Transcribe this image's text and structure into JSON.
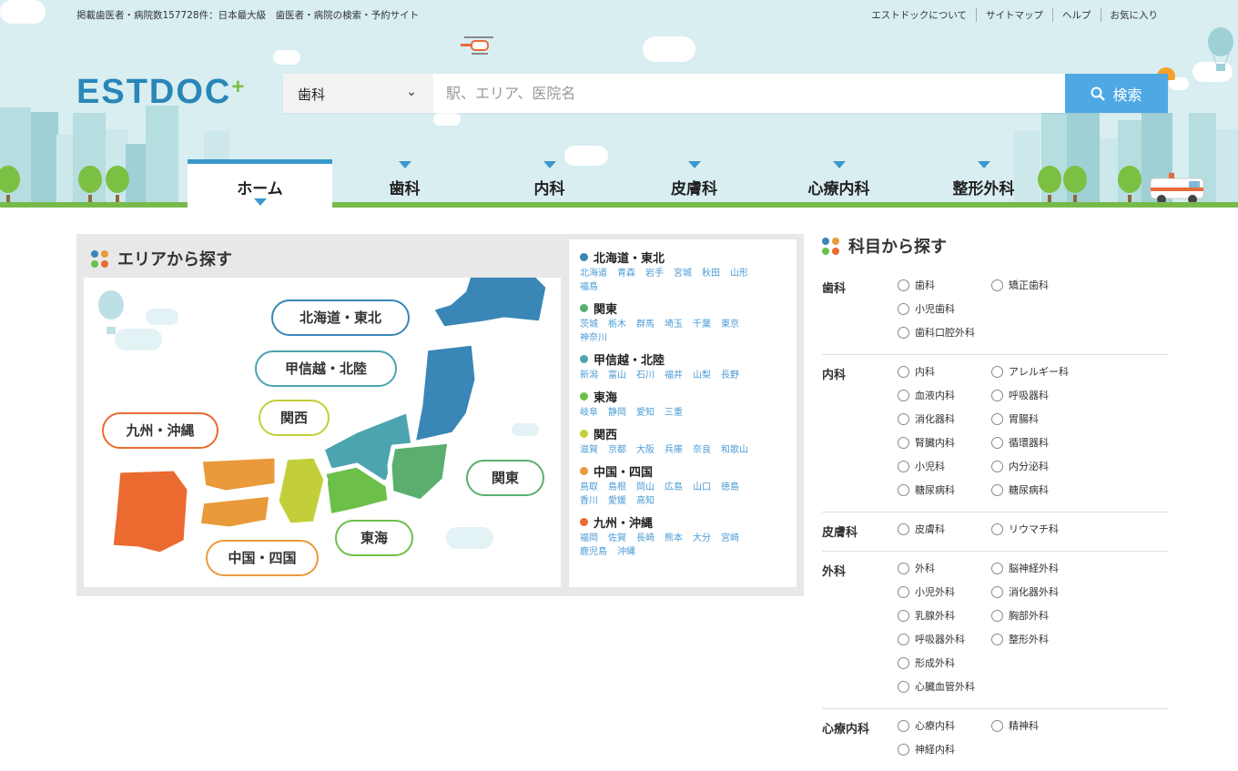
{
  "header": {
    "tagline": "掲載歯医者・病院数157728件：日本最大級　歯医者・病院の検索・予約サイト",
    "links": [
      "エストドックについて",
      "サイトマップ",
      "ヘルプ",
      "お気に入り"
    ],
    "logo_text": "ESTDOC",
    "logo_plus": "+"
  },
  "search": {
    "category_value": "歯科",
    "placeholder": "駅、エリア、医院名",
    "button_label": "検索"
  },
  "nav": {
    "tabs": [
      {
        "label": "ホーム",
        "active": true
      },
      {
        "label": "歯科"
      },
      {
        "label": "内科"
      },
      {
        "label": "皮膚科"
      },
      {
        "label": "心療内科"
      },
      {
        "label": "整形外科"
      }
    ]
  },
  "area": {
    "title": "エリアから探す",
    "map_labels": {
      "hokkaido": "北海道・東北",
      "koshinetsu": "甲信越・北陸",
      "kansai": "関西",
      "kyushu": "九州・沖縄",
      "kanto": "関東",
      "tokai": "東海",
      "chugoku": "中国・四国"
    },
    "regions": [
      {
        "name": "北海道・東北",
        "color": "#3a86b6",
        "prefs": [
          "北海道",
          "青森",
          "岩手",
          "宮城",
          "秋田",
          "山形",
          "福島"
        ]
      },
      {
        "name": "関東",
        "color": "#5aaf6e",
        "prefs": [
          "茨城",
          "栃木",
          "群馬",
          "埼玉",
          "千葉",
          "東京",
          "神奈川"
        ]
      },
      {
        "name": "甲信越・北陸",
        "color": "#4ba4b0",
        "prefs": [
          "新潟",
          "富山",
          "石川",
          "福井",
          "山梨",
          "長野"
        ]
      },
      {
        "name": "東海",
        "color": "#6cc04a",
        "prefs": [
          "岐阜",
          "静岡",
          "愛知",
          "三重"
        ]
      },
      {
        "name": "関西",
        "color": "#c2cf3a",
        "prefs": [
          "滋賀",
          "京都",
          "大阪",
          "兵庫",
          "奈良",
          "和歌山"
        ]
      },
      {
        "name": "中国・四国",
        "color": "#ea9a3a",
        "prefs": [
          "鳥取",
          "島根",
          "岡山",
          "広島",
          "山口",
          "徳島",
          "香川",
          "愛媛",
          "高知"
        ]
      },
      {
        "name": "九州・沖縄",
        "color": "#ea6a30",
        "prefs": [
          "福岡",
          "佐賀",
          "長崎",
          "熊本",
          "大分",
          "宮崎",
          "鹿児島",
          "沖縄"
        ]
      }
    ]
  },
  "departments": {
    "title": "科目から探す",
    "groups": [
      {
        "name": "歯科",
        "options": [
          "歯科",
          "矯正歯科",
          "小児歯科",
          "歯科口腔外科"
        ]
      },
      {
        "name": "内科",
        "options": [
          "内科",
          "アレルギー科",
          "血液内科",
          "呼吸器科",
          "消化器科",
          "胃腸科",
          "腎臓内科",
          "循環器科",
          "小児科",
          "内分泌科",
          "糖尿病科",
          "糖尿病科"
        ]
      },
      {
        "name": "皮膚科",
        "options": [
          "皮膚科",
          "リウマチ科"
        ]
      },
      {
        "name": "外科",
        "options": [
          "外科",
          "脳神経外科",
          "小児外科",
          "消化器外科",
          "乳腺外科",
          "胸部外科",
          "呼吸器外科",
          "整形外科",
          "形成外科",
          "心臓血管外科"
        ]
      },
      {
        "name": "心療内科",
        "options": [
          "心療内科",
          "精神科",
          "神経内科"
        ]
      }
    ]
  },
  "colors": {
    "accent": "#3a98cf",
    "search_button": "#4ea8e3",
    "sky": "#d8eef1"
  }
}
